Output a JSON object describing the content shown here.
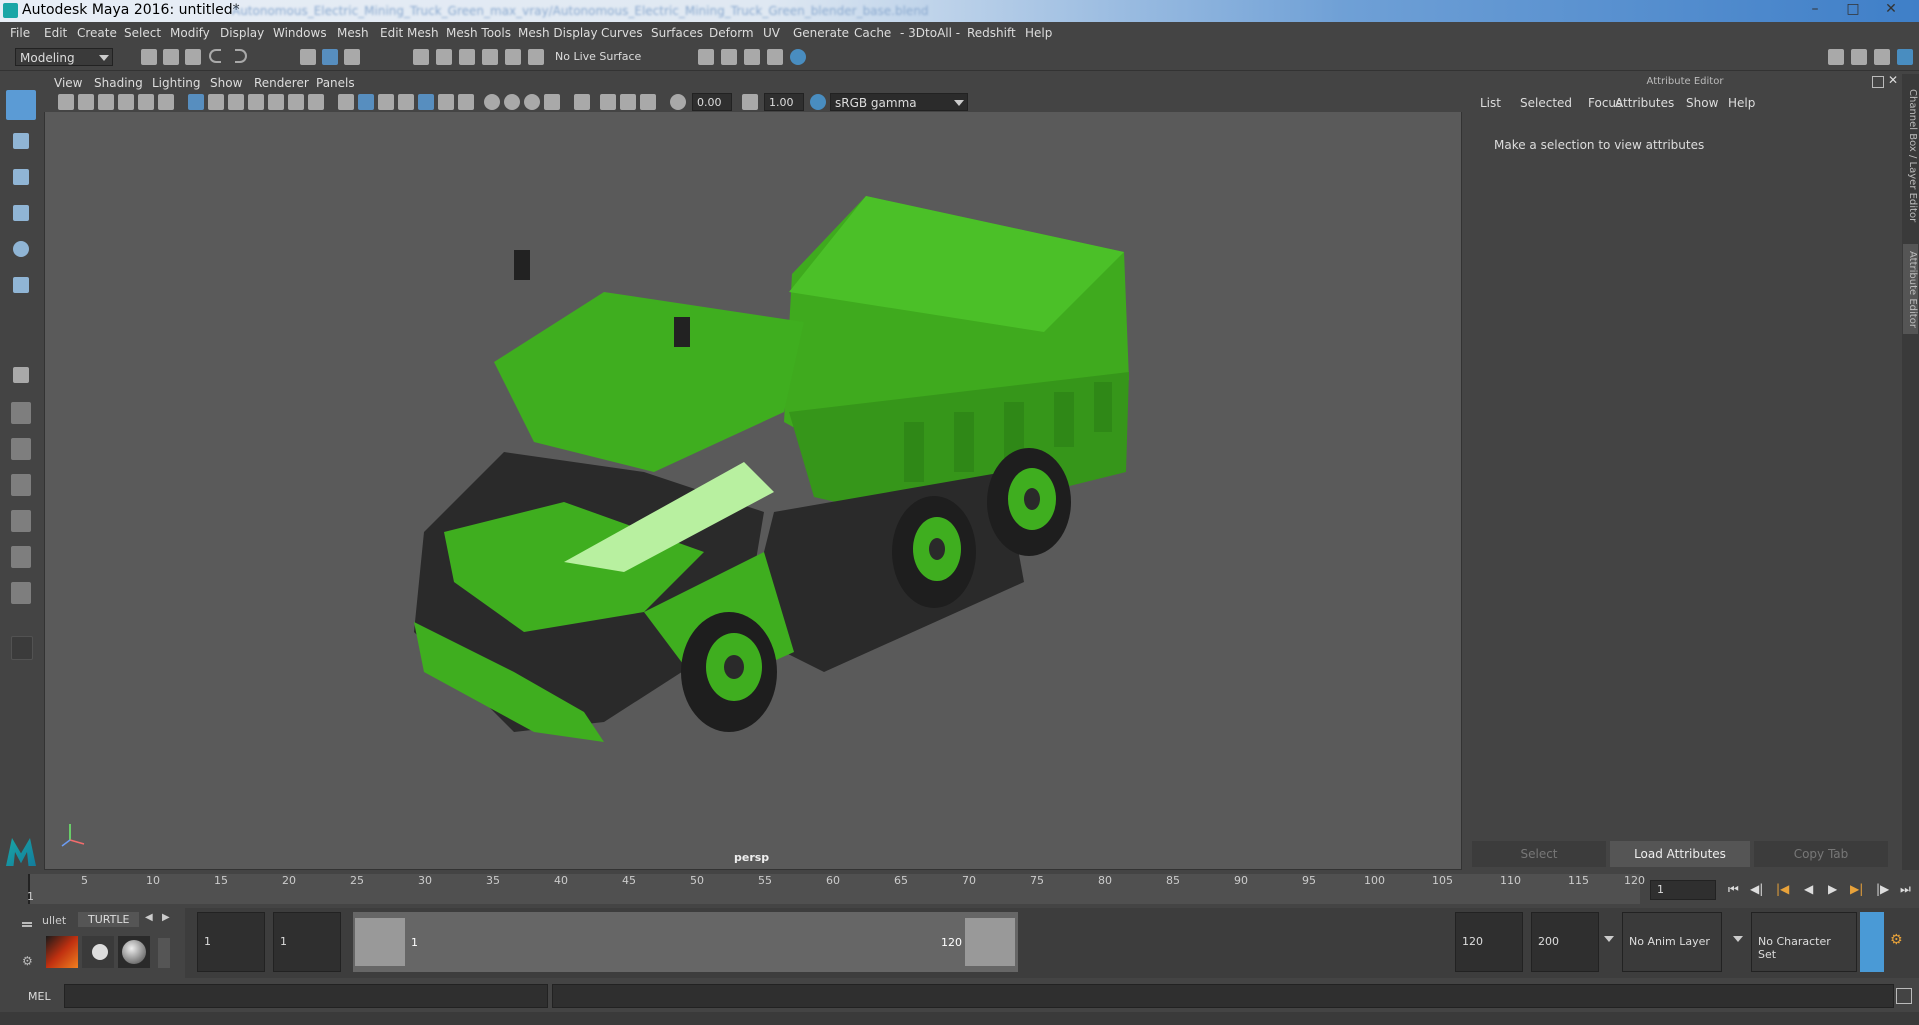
{
  "window": {
    "title": "Autodesk Maya 2016: untitled*",
    "path_hint": "Autonomous_Electric_Mining_Truck_Green_max_vray/Autonomous_Electric_Mining_Truck_Green_blender_base.blend"
  },
  "menu": [
    "File",
    "Edit",
    "Create",
    "Select",
    "Modify",
    "Display",
    "Windows",
    "Mesh",
    "Edit Mesh",
    "Mesh Tools",
    "Mesh Display",
    "Curves",
    "Surfaces",
    "Deform",
    "UV",
    "Generate",
    "Cache",
    "- 3DtoAll -",
    "Redshift",
    "Help"
  ],
  "status": {
    "mode": "Modeling",
    "live_surface": "No Live Surface"
  },
  "viewport": {
    "menu": [
      "View",
      "Shading",
      "Lighting",
      "Show",
      "Renderer",
      "Panels"
    ],
    "exposure": "0.00",
    "gamma": "1.00",
    "color_space": "sRGB gamma",
    "camera": "persp"
  },
  "attribute_editor": {
    "header": "Attribute Editor",
    "menu": [
      "List",
      "Selected",
      "Focus",
      "Attributes",
      "Show",
      "Help"
    ],
    "message": "Make a selection to view attributes",
    "buttons": {
      "select": "Select",
      "load": "Load Attributes",
      "copy": "Copy Tab"
    },
    "side_tabs": [
      "Channel Box / Layer Editor",
      "Attribute Editor"
    ]
  },
  "timeline": {
    "ticks": [
      "1",
      "5",
      "10",
      "15",
      "20",
      "25",
      "30",
      "35",
      "40",
      "45",
      "50",
      "55",
      "60",
      "65",
      "70",
      "75",
      "80",
      "85",
      "90",
      "95",
      "100",
      "105",
      "110",
      "115",
      "120"
    ],
    "current_frame": "1"
  },
  "range": {
    "start": "1",
    "playback_start": "1",
    "slider_start": "1",
    "slider_end": "120",
    "playback_end": "120",
    "end": "200",
    "anim_layer": "No Anim Layer",
    "character_set": "No Character Set"
  },
  "shelf": {
    "tabs": [
      "ullet",
      "TURTLE"
    ]
  },
  "cmd": {
    "label": "MEL"
  },
  "colors": {
    "truck_green": "#3fae1f",
    "truck_dark": "#2a2a2a",
    "viewport_bg": "#5a5a5a",
    "accent_blue": "#4a9ad6"
  }
}
